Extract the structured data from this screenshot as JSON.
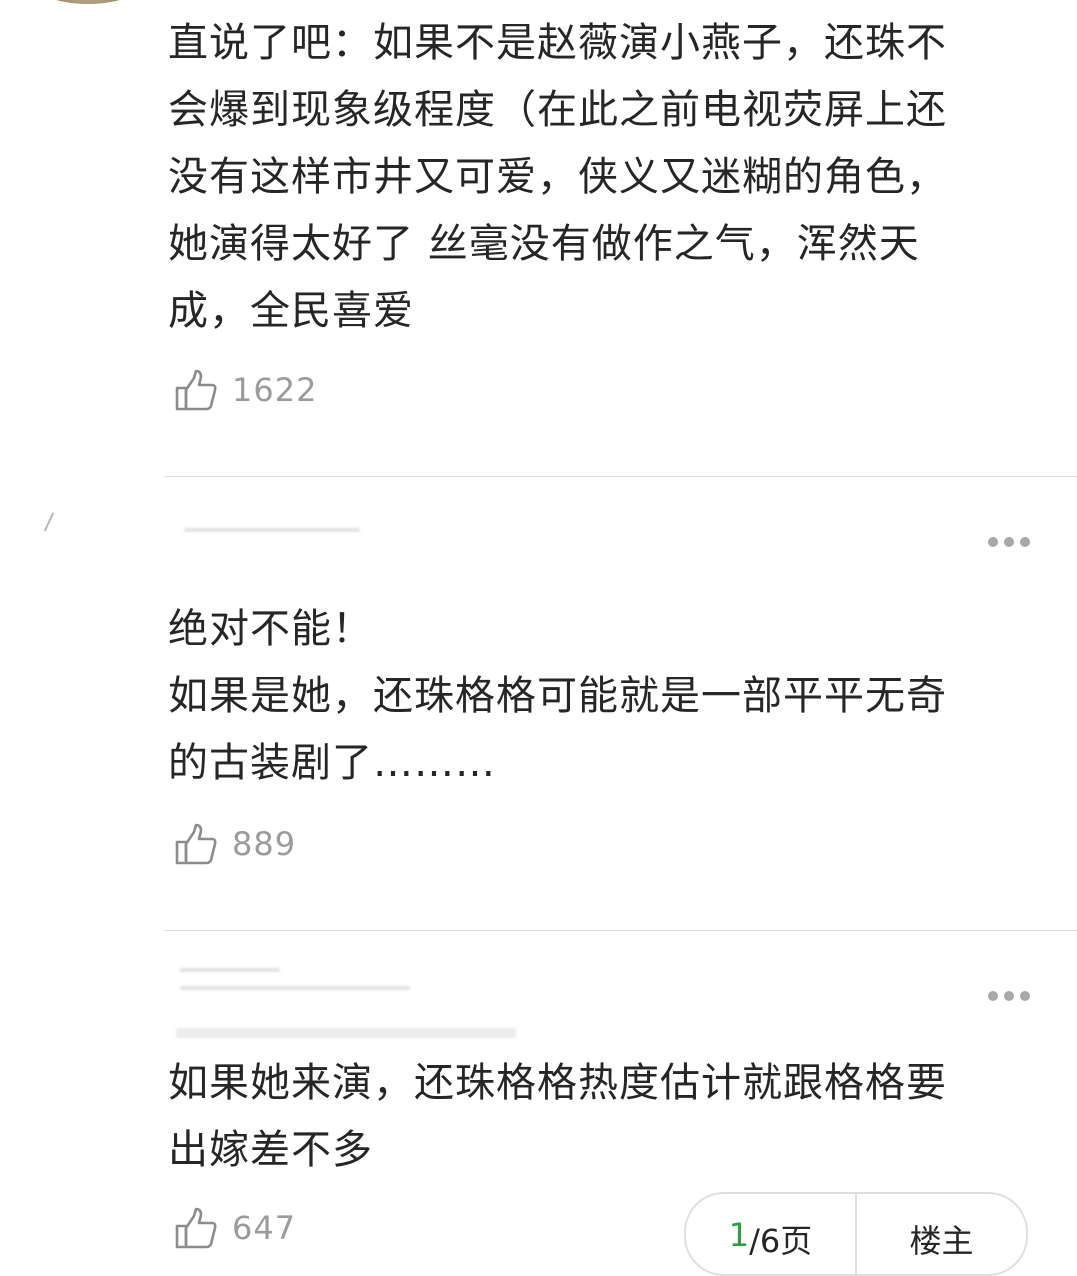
{
  "comments": [
    {
      "text": "直说了吧：如果不是赵薇演小燕子，还珠不\n会爆到现象级程度（在此之前电视荧屏上还\n没有这样市井又可爱，侠义又迷糊的角色，\n她演得太好了 丝毫没有做作之气，浑然天\n成，全民喜爱",
      "likes": "1622"
    },
    {
      "text": "绝对不能！\n如果是她，还珠格格可能就是一部平平无奇\n的古装剧了………",
      "likes": "889"
    },
    {
      "text": "如果她来演，还珠格格热度估计就跟格格要\n出嫁差不多",
      "likes": "647"
    }
  ],
  "pager": {
    "current": "1",
    "total_label": "/6页",
    "landlord_label": "楼主"
  },
  "icons": {
    "like": "thumbs-up-icon",
    "more": "more-dots-icon"
  },
  "colors": {
    "text": "#262626",
    "muted": "#9b9b9b",
    "divider": "#dcdcdc",
    "accent": "#2f9e3f"
  }
}
